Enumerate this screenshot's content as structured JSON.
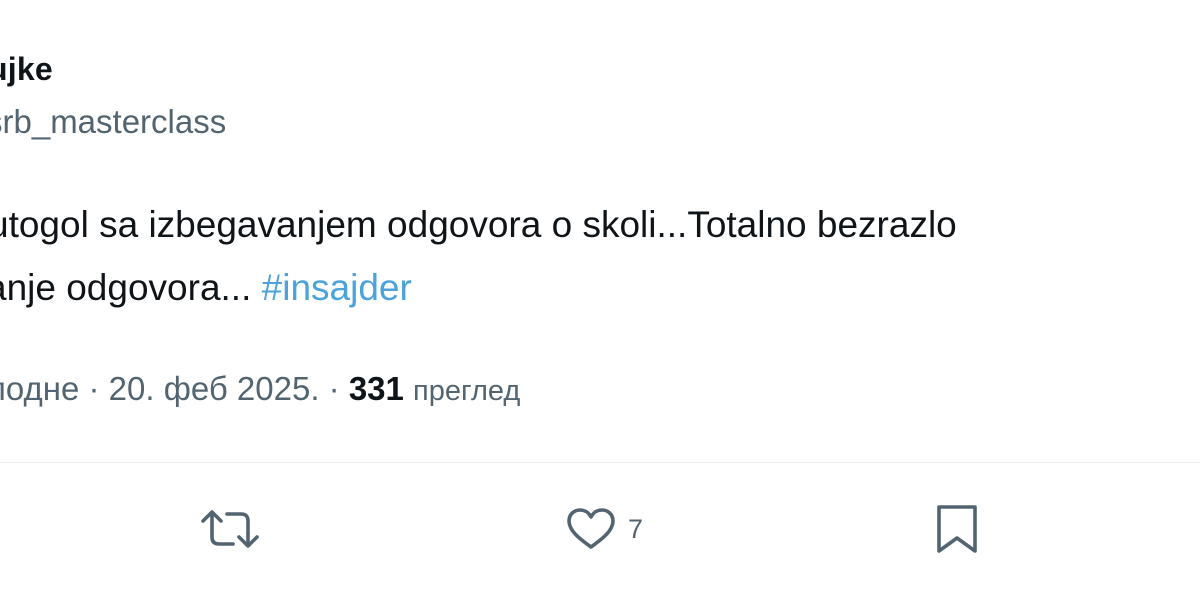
{
  "author": {
    "name": "ujke",
    "handle": "srb_masterclass"
  },
  "body": {
    "line1": "utogol sa izbegavanjem odgovora o skoli...Totalno bezrazlo",
    "line2_text": "anje odgovora... ",
    "hashtag": "#insajder"
  },
  "meta": {
    "datetime": "подне · 20. феб 2025. · ",
    "views_count": "331",
    "views_label": "преглед"
  },
  "actions": {
    "retweet_icon": "retweet-icon",
    "like_icon": "heart-icon",
    "like_count": "7",
    "bookmark_icon": "bookmark-icon"
  },
  "colors": {
    "text": "#0f1419",
    "secondary": "#536471",
    "hashtag": "#4ba3d9",
    "divider": "#e6ecf0"
  }
}
